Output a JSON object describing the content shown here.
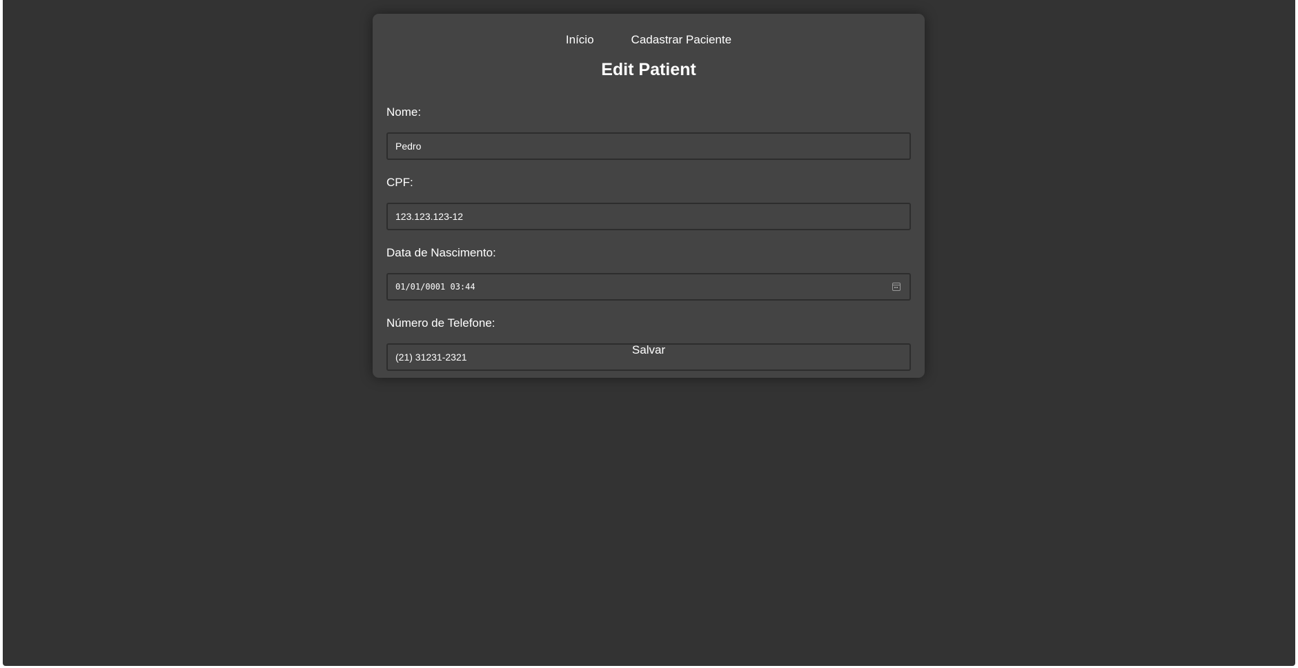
{
  "nav": {
    "home_label": "Início",
    "register_label": "Cadastrar Paciente"
  },
  "page": {
    "title": "Edit Patient"
  },
  "form": {
    "name": {
      "label": "Nome:",
      "value": "Pedro"
    },
    "cpf": {
      "label": "CPF:",
      "value": "123.123.123-12"
    },
    "birth_date": {
      "label": "Data de Nascimento:",
      "value": "01/01/0001 03:44",
      "icon": "calendar-icon"
    },
    "phone": {
      "label": "Número de Telefone:",
      "value": "(21) 31231-2321"
    },
    "save_label": "Salvar"
  },
  "colors": {
    "background": "#333333",
    "card": "#444444",
    "text": "#ffffff",
    "input_border": "#2d2d2d"
  }
}
